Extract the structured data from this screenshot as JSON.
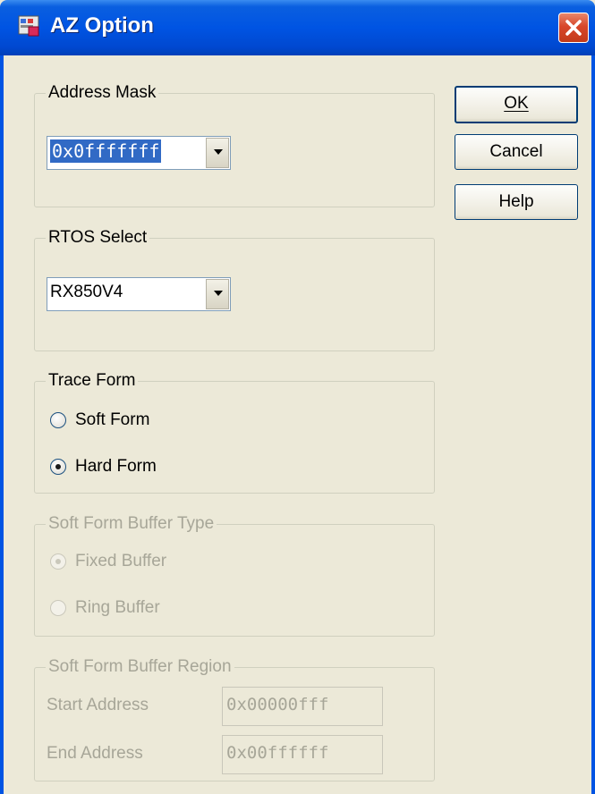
{
  "window": {
    "title": "AZ Option",
    "icon": "app-icon",
    "close": "close-icon"
  },
  "address_mask": {
    "label": "Address Mask",
    "value": "0x0fffffff"
  },
  "rtos_select": {
    "label": "RTOS Select",
    "value": "RX850V4"
  },
  "trace_form": {
    "label": "Trace Form",
    "options": [
      "Soft Form",
      "Hard Form"
    ],
    "selected": "Hard Form"
  },
  "buffer_type": {
    "label": "Soft Form Buffer Type",
    "options": [
      "Fixed Buffer",
      "Ring Buffer"
    ],
    "selected": "Fixed Buffer",
    "enabled": false
  },
  "buffer_region": {
    "label": "Soft Form Buffer Region",
    "start_label": "Start Address",
    "start_value": "0x00000fff",
    "end_label": "End Address",
    "end_value": "0x00ffffff",
    "enabled": false
  },
  "buttons": {
    "ok": "OK",
    "cancel": "Cancel",
    "help": "Help"
  },
  "colors": {
    "titlebar": "#0054e3",
    "face": "#ece9d8",
    "selection": "#316ac5",
    "disabled_text": "#a7a698"
  }
}
